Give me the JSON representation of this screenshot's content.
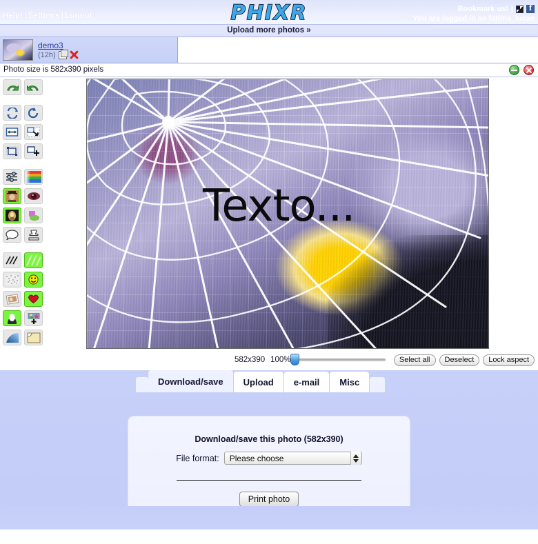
{
  "header": {
    "nav": [
      {
        "label": "Help!"
      },
      {
        "label": "Settings"
      },
      {
        "label": "Logout"
      }
    ],
    "separator": "|",
    "logo": "PHIXR",
    "bookmark_label": "Bookmark us!",
    "logged_in_text": "You are logged in as fatima_lucas",
    "upload_more_label": "Upload more photos »"
  },
  "photo_strip": {
    "items": [
      {
        "name": "demo3",
        "age": "(12h)",
        "copy_icon": "copy-icon",
        "delete_icon": "delete-icon"
      }
    ]
  },
  "size_bar": {
    "text": "Photo size is 582x390 pixels",
    "apply_icon": "apply-icon",
    "cancel_icon": "cancel-icon"
  },
  "toolbar": {
    "tools": [
      {
        "name": "undo",
        "label": "Undo"
      },
      {
        "name": "redo",
        "label": "Redo"
      },
      {
        "name": "rotate-flip",
        "label": "Rotate / Flip"
      },
      {
        "name": "rotate-free",
        "label": "Rotate freely"
      },
      {
        "name": "mirror",
        "label": "Mirror"
      },
      {
        "name": "resize",
        "label": "Resize"
      },
      {
        "name": "crop",
        "label": "Crop"
      },
      {
        "name": "canvas-add",
        "label": "Enlarge canvas"
      },
      {
        "name": "adjust-levels",
        "label": "Adjust"
      },
      {
        "name": "color-palette",
        "label": "Colors"
      },
      {
        "name": "effects-portrait",
        "label": "Effects",
        "active": true
      },
      {
        "name": "red-eye",
        "label": "Red eye"
      },
      {
        "name": "distort-portrait",
        "label": "Distort",
        "active": true
      },
      {
        "name": "shapes-blend",
        "label": "Shapes"
      },
      {
        "name": "speech-bubble",
        "label": "Speech bubble"
      },
      {
        "name": "stamp",
        "label": "Stamp"
      },
      {
        "name": "lines",
        "label": "Lines"
      },
      {
        "name": "texture-lines",
        "label": "Texture",
        "active": true
      },
      {
        "name": "noise",
        "label": "Noise"
      },
      {
        "name": "smiley",
        "label": "Smiley",
        "active": true
      },
      {
        "name": "photo-frame",
        "label": "Frame"
      },
      {
        "name": "heart",
        "label": "Heart",
        "active": true
      },
      {
        "name": "mask-portrait",
        "label": "Mask",
        "active": true
      },
      {
        "name": "add-photo",
        "label": "Add photo"
      },
      {
        "name": "gradient",
        "label": "Gradient"
      },
      {
        "name": "page-curl",
        "label": "Page curl"
      }
    ]
  },
  "canvas": {
    "photo_text": "Texto...",
    "alt": "Spider web over a purple crocus flower"
  },
  "controls": {
    "dimensions": "582x390",
    "zoom": "100%",
    "zoom_value": 0,
    "select_all_label": "Select all",
    "deselect_label": "Deselect",
    "lock_aspect_label": "Lock aspect"
  },
  "tabs": {
    "items": [
      {
        "label": "Download/save",
        "selected": true
      },
      {
        "label": "Upload",
        "selected": false
      },
      {
        "label": "e-mail",
        "selected": false
      },
      {
        "label": "Misc",
        "selected": false
      }
    ]
  },
  "panel": {
    "title": "Download/save this photo (582x390)",
    "file_format_label": "File format:",
    "file_format_value": "Please choose",
    "file_format_options": [
      "Please choose"
    ],
    "print_button_label": "Print photo"
  }
}
